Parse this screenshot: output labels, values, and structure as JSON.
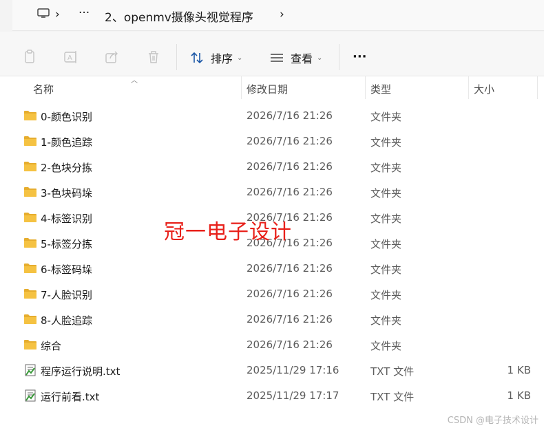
{
  "address": {
    "more": "···",
    "path": "2、openmv摄像头视觉程序"
  },
  "toolbar": {
    "sort_label": "排序",
    "view_label": "查看",
    "more_label": "···"
  },
  "columns": {
    "name": "名称",
    "date": "修改日期",
    "type": "类型",
    "size": "大小"
  },
  "files": [
    {
      "name": "0-颜色识别",
      "date": "2026/7/16 21:26",
      "type": "文件夹",
      "size": "",
      "icon": "folder-icon"
    },
    {
      "name": "1-颜色追踪",
      "date": "2026/7/16 21:26",
      "type": "文件夹",
      "size": "",
      "icon": "folder-icon"
    },
    {
      "name": "2-色块分拣",
      "date": "2026/7/16 21:26",
      "type": "文件夹",
      "size": "",
      "icon": "folder-icon"
    },
    {
      "name": "3-色块码垛",
      "date": "2026/7/16 21:26",
      "type": "文件夹",
      "size": "",
      "icon": "folder-icon"
    },
    {
      "name": "4-标签识别",
      "date": "2026/7/16 21:26",
      "type": "文件夹",
      "size": "",
      "icon": "folder-icon"
    },
    {
      "name": "5-标签分拣",
      "date": "2026/7/16 21:26",
      "type": "文件夹",
      "size": "",
      "icon": "folder-icon"
    },
    {
      "name": "6-标签码垛",
      "date": "2026/7/16 21:26",
      "type": "文件夹",
      "size": "",
      "icon": "folder-icon"
    },
    {
      "name": "7-人脸识别",
      "date": "2026/7/16 21:26",
      "type": "文件夹",
      "size": "",
      "icon": "folder-icon"
    },
    {
      "name": "8-人脸追踪",
      "date": "2026/7/16 21:26",
      "type": "文件夹",
      "size": "",
      "icon": "folder-icon"
    },
    {
      "name": "综合",
      "date": "2026/7/16 21:26",
      "type": "文件夹",
      "size": "",
      "icon": "folder-icon"
    },
    {
      "name": "程序运行说明.txt",
      "date": "2025/11/29 17:16",
      "type": "TXT 文件",
      "size": "1 KB",
      "icon": "text-file-icon"
    },
    {
      "name": "运行前看.txt",
      "date": "2025/11/29 17:17",
      "type": "TXT 文件",
      "size": "1 KB",
      "icon": "text-file-icon"
    }
  ],
  "overlay": {
    "watermark": "冠一电子设计",
    "csdn": "CSDN @电子技术设计"
  },
  "colors": {
    "folder": "#f5c242",
    "watermark": "#e8201a"
  }
}
